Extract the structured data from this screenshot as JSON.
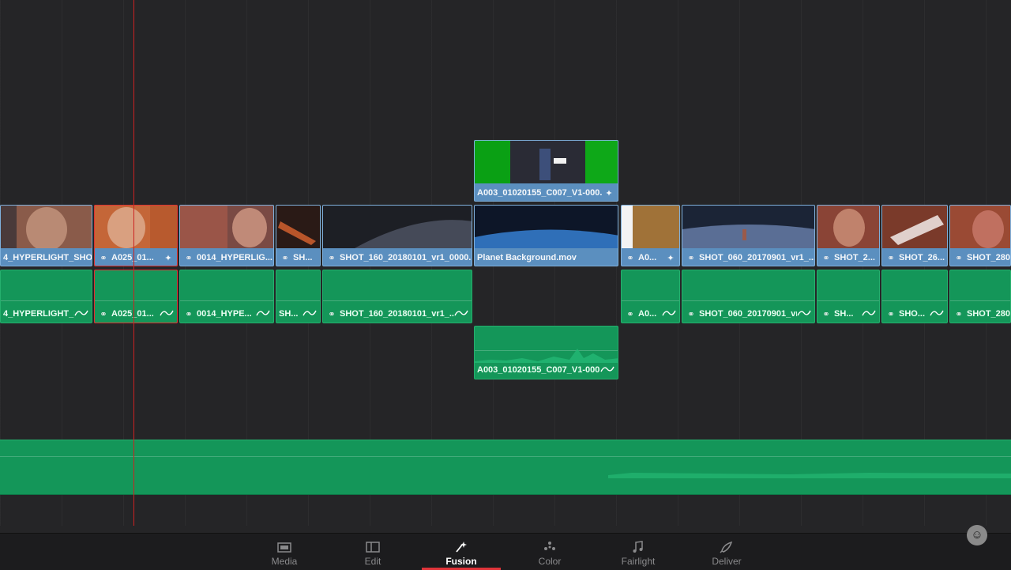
{
  "video_track_2": [
    {
      "label": "A003_01020155_C007_V1-000...",
      "link": false,
      "fx": true
    }
  ],
  "video_track_1": [
    {
      "label": "4_HYPERLIGHT_SHOT...",
      "link": false,
      "fx": false
    },
    {
      "label": "A025_01...",
      "link": true,
      "fx": true
    },
    {
      "label": "0014_HYPERLIG...",
      "link": true,
      "fx": false
    },
    {
      "label": "SH...",
      "link": true,
      "fx": false
    },
    {
      "label": "SHOT_160_20180101_vr1_0000...",
      "link": true,
      "fx": false
    },
    {
      "label": "Planet Background.mov",
      "link": false,
      "fx": false
    },
    {
      "label": "A0...",
      "link": true,
      "fx": true
    },
    {
      "label": "SHOT_060_20170901_vr1_...",
      "link": true,
      "fx": false
    },
    {
      "label": "SHOT_2...",
      "link": true,
      "fx": false
    },
    {
      "label": "SHOT_26...",
      "link": true,
      "fx": false
    },
    {
      "label": "SHOT_280...",
      "link": true,
      "fx": false
    }
  ],
  "audio_track_1": [
    {
      "label": "4_HYPERLIGHT_S...",
      "link": false
    },
    {
      "label": "A025_01...",
      "link": true
    },
    {
      "label": "0014_HYPE...",
      "link": true
    },
    {
      "label": "SH...",
      "link": false
    },
    {
      "label": "SHOT_160_20180101_vr1_...",
      "link": true
    },
    {
      "label": "A0...",
      "link": true
    },
    {
      "label": "SHOT_060_20170901_vr1_...",
      "link": true
    },
    {
      "label": "SH...",
      "link": true
    },
    {
      "label": "SHO...",
      "link": true
    },
    {
      "label": "SHOT_280...",
      "link": true
    }
  ],
  "audio_track_2": [
    {
      "label": "A003_01020155_C007_V1-000..."
    }
  ],
  "page_bar": {
    "active": "Fusion",
    "pages": [
      {
        "label": "Media",
        "icon": "media-icon"
      },
      {
        "label": "Edit",
        "icon": "edit-icon"
      },
      {
        "label": "Fusion",
        "icon": "fusion-icon"
      },
      {
        "label": "Color",
        "icon": "color-icon"
      },
      {
        "label": "Fairlight",
        "icon": "fairlight-icon"
      },
      {
        "label": "Deliver",
        "icon": "deliver-icon"
      }
    ]
  },
  "colors": {
    "video_clip": "#5b8fbf",
    "audio_clip": "#149659",
    "playhead": "#c22222",
    "active_page": "#e0343a",
    "background": "#252527"
  }
}
